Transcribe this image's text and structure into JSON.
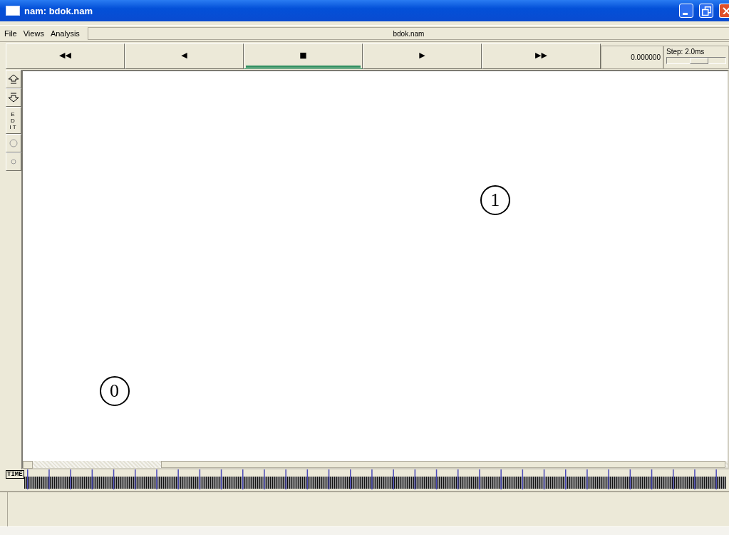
{
  "window": {
    "title": "nam: bdok.nam"
  },
  "menu": [
    {
      "label": "File"
    },
    {
      "label": "Views"
    },
    {
      "label": "Analysis"
    }
  ],
  "file_label": "bdok.nam",
  "transport": [
    {
      "symbol": "◀◀",
      "selected": false
    },
    {
      "symbol": "◀",
      "selected": false
    },
    {
      "symbol": "■",
      "selected": true
    },
    {
      "symbol": "▶",
      "selected": false
    },
    {
      "symbol": "▶▶",
      "selected": false
    }
  ],
  "time": "0.000000",
  "step": {
    "label": "Step: 2.0ms",
    "level": 0.55
  },
  "tools": [
    {
      "kind": "up"
    },
    {
      "kind": "down"
    },
    {
      "kind": "text",
      "label": "ED IT"
    },
    {
      "kind": "circle"
    },
    {
      "kind": "dot"
    }
  ],
  "nodes": [
    {
      "label": "0"
    },
    {
      "label": "1"
    }
  ],
  "timeline": {
    "label": "TIME"
  }
}
